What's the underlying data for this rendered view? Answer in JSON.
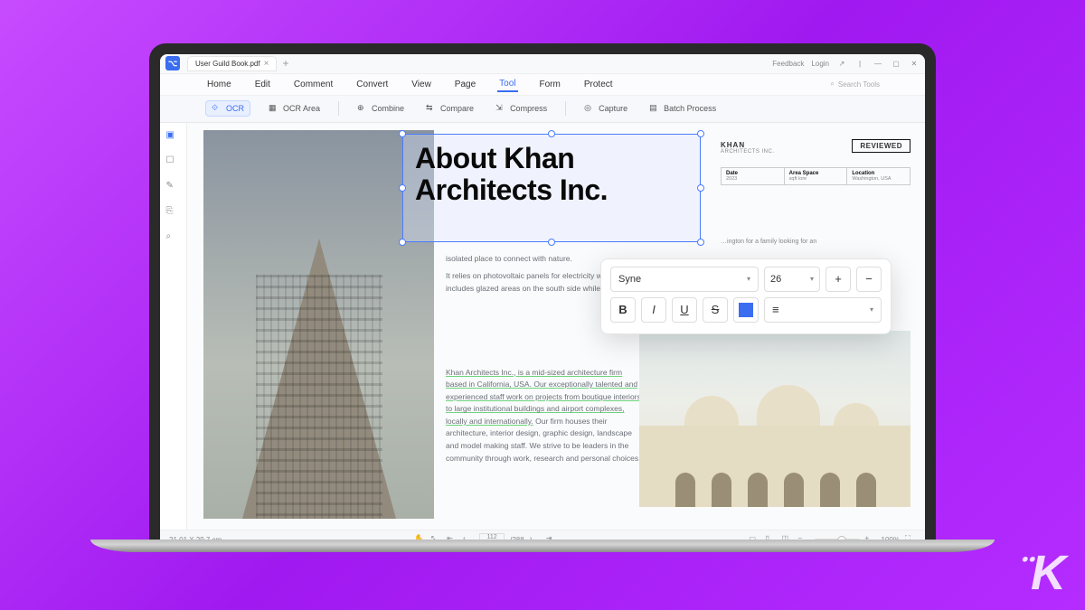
{
  "titlebar": {
    "file_name": "User Guild Book.pdf",
    "feedback": "Feedback",
    "login": "Login"
  },
  "menu": {
    "items": [
      "Home",
      "Edit",
      "Comment",
      "Convert",
      "View",
      "Page",
      "Tool",
      "Form",
      "Protect"
    ],
    "active_index": 6,
    "search_placeholder": "Search Tools"
  },
  "toolbar": {
    "items": [
      {
        "icon": "ocr-icon",
        "label": "OCR",
        "active": true
      },
      {
        "icon": "ocr-area-icon",
        "label": "OCR Area"
      },
      {
        "icon": "combine-icon",
        "label": "Combine"
      },
      {
        "icon": "compare-icon",
        "label": "Compare"
      },
      {
        "icon": "compress-icon",
        "label": "Compress"
      },
      {
        "icon": "capture-icon",
        "label": "Capture"
      },
      {
        "icon": "batch-icon",
        "label": "Batch Process"
      }
    ]
  },
  "sidebar": {
    "items": [
      "thumbnails-icon",
      "bookmark-icon",
      "comments-icon",
      "attachments-icon",
      "search-icon"
    ]
  },
  "doc": {
    "headline_l1": "About Khan",
    "headline_l2": "Architects Inc.",
    "brand": "KHAN",
    "brand_sub": "ARCHITECTS INC.",
    "reviewed": "REVIEWED",
    "meta": {
      "col1_lbl": "Date",
      "col1_val": "2023",
      "col2_lbl": "Area Space",
      "col2_val": "sqft lore",
      "col3_lbl": "Location",
      "col3_val": "Washington, USA"
    },
    "caption": "…ington for a family looking for an",
    "line1": "isolated place to connect with nature.",
    "line2": "It relies on photovoltaic panels for electricity while also allowing a passive temperature. This includes glazed areas on the south side while the extended west-facing roof provides shade.",
    "para2_hl": "Khan Architects Inc., is a mid-sized architecture firm based in California, USA. Our exceptionally talented and experienced staff work on projects from boutique interiors to large institutional buildings and airport complexes, locally and internationally.",
    "para2_rest": " Our firm houses their architecture, interior design, graphic design, landscape and model making staff. We strive to be leaders in the community through work, research and personal choices."
  },
  "fmt": {
    "font": "Syne",
    "size": "26",
    "color": "#3a6df0"
  },
  "status": {
    "dims": "21.01 X 29.7 cm",
    "page_current": "112",
    "page_total": "/288",
    "zoom": "100%"
  }
}
